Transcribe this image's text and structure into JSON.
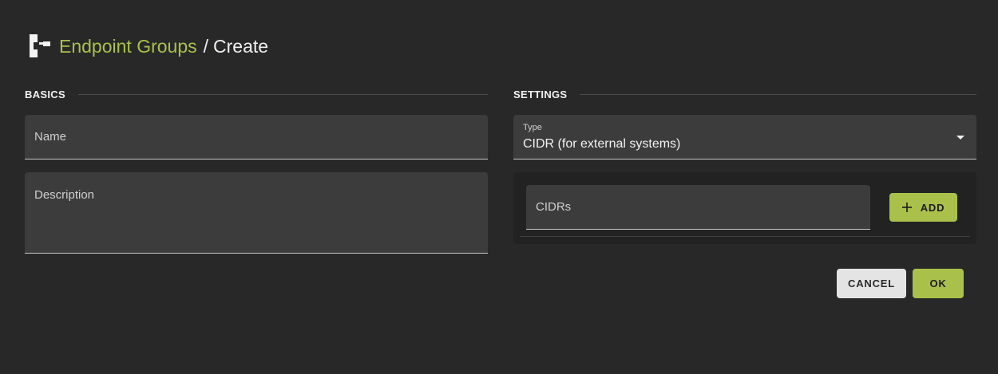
{
  "header": {
    "icon": "endpoint-groups-icon",
    "breadcrumb_link": "Endpoint Groups",
    "separator": "/",
    "current": "Create"
  },
  "basics": {
    "heading": "BASICS",
    "name_placeholder": "Name",
    "description_placeholder": "Description"
  },
  "settings": {
    "heading": "SETTINGS",
    "type_label": "Type",
    "type_value": "CIDR (for external systems)",
    "cidrs_placeholder": "CIDRs",
    "add_label": "Add"
  },
  "actions": {
    "cancel_label": "Cancel",
    "ok_label": "OK"
  },
  "colors": {
    "accent": "#a9c14a",
    "background": "#282828",
    "field": "#3c3c3c"
  }
}
